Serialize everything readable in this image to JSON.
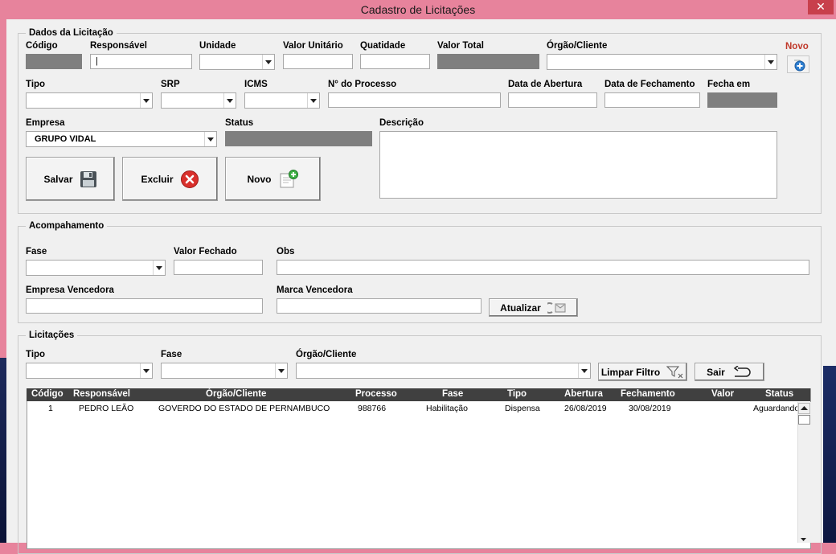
{
  "window": {
    "title": "Cadastro de Licitações",
    "close_glyph": "✕"
  },
  "dados": {
    "legend": "Dados da Licitação",
    "labels": {
      "codigo": "Código",
      "responsavel": "Responsável",
      "unidade": "Unidade",
      "valor_unitario": "Valor Unitário",
      "quantidade": "Quatidade",
      "valor_total": "Valor Total",
      "orgao_cliente": "Órgão/Cliente",
      "novo": "Novo",
      "tipo": "Tipo",
      "srp": "SRP",
      "icms": "ICMS",
      "processo": "N° do Processo",
      "data_abertura": "Data de Abertura",
      "data_fechamento": "Data de Fechamento",
      "fecha_em": "Fecha em",
      "empresa": "Empresa",
      "status": "Status",
      "descricao": "Descrição"
    },
    "values": {
      "empresa": "GRUPO VIDAL",
      "responsavel_cursor": "|"
    },
    "buttons": {
      "salvar": "Salvar",
      "excluir": "Excluir",
      "novo": "Novo"
    }
  },
  "acompanhamento": {
    "legend": "Acompahamento",
    "labels": {
      "fase": "Fase",
      "valor_fechado": "Valor Fechado",
      "obs": "Obs",
      "empresa_vencedora": "Empresa Vencedora",
      "marca_vencedora": "Marca Vencedora"
    },
    "buttons": {
      "atualizar": "Atualizar"
    }
  },
  "licitacoes": {
    "legend": "Licitações",
    "labels": {
      "tipo": "Tipo",
      "fase": "Fase",
      "orgao_cliente": "Órgão/Cliente"
    },
    "buttons": {
      "limpar_filtro": "Limpar Filtro",
      "sair": "Sair"
    },
    "table": {
      "columns": [
        "Código",
        "Responsável",
        "Órgão/Cliente",
        "Processo",
        "Fase",
        "Tipo",
        "Abertura",
        "Fechamento",
        "Valor",
        "Status"
      ],
      "rows": [
        [
          "1",
          "PEDRO LEÃO",
          "GOVERDO DO ESTADO DE PERNAMBUCO",
          "988766",
          "Habilitação",
          "Dispensa",
          "26/08/2019",
          "30/08/2019",
          "",
          "Aguardando"
        ]
      ]
    }
  },
  "colors": {
    "titlebar": "#e7839c",
    "close": "#c8404c",
    "form_bg": "#f0f0f0",
    "header_bg": "#404040",
    "disabled_field": "#7f7f7f"
  }
}
